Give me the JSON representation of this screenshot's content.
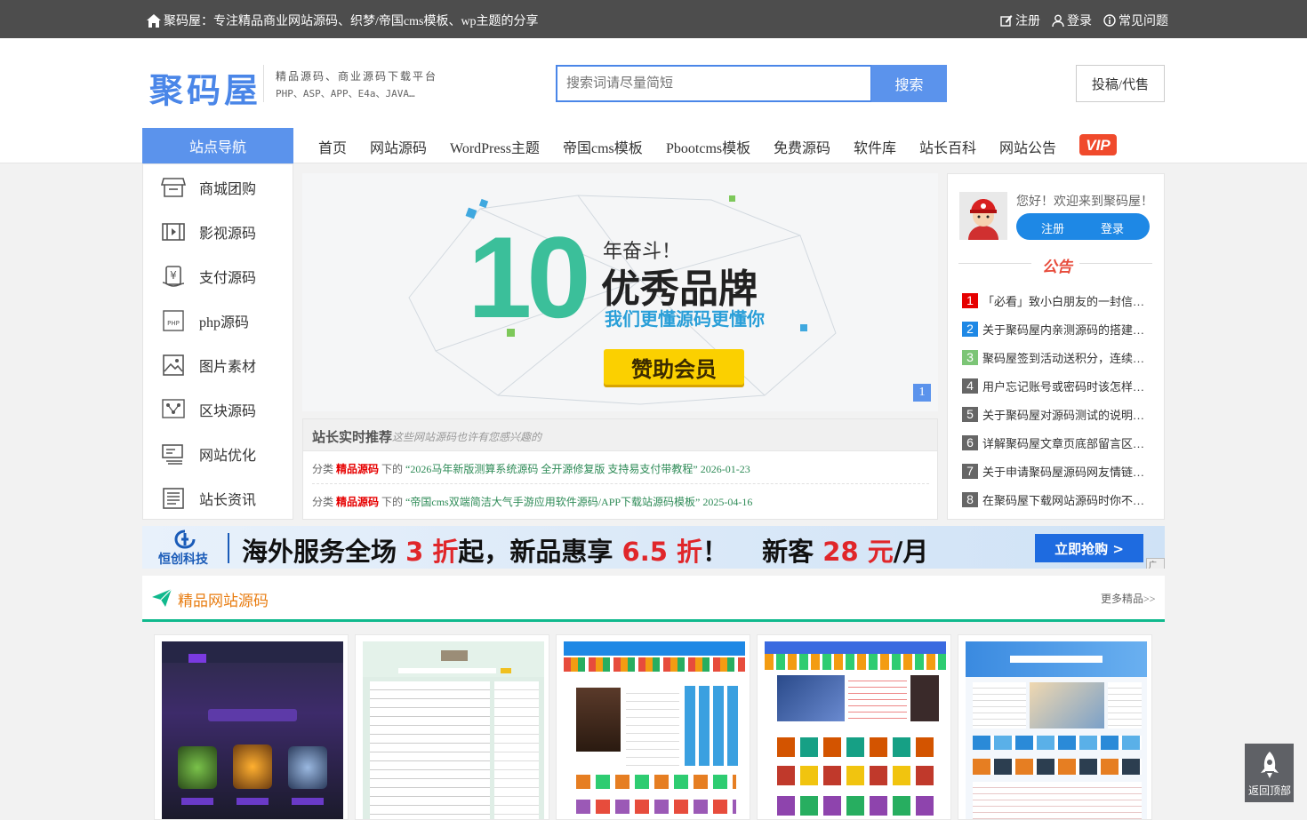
{
  "colors": {
    "topbar": "#4d4d4d",
    "accent": "#4a86e8",
    "red": "#e60000",
    "green": "#10b98d"
  },
  "topbar": {
    "slogan": "聚码屋：专注精品商业网站源码、织梦/帝国cms模板、wp主题的分享",
    "register": "注册",
    "login": "登录",
    "faq": "常见问题"
  },
  "header": {
    "logo": "聚码屋",
    "tagline1": "精品源码、商业源码下载平台",
    "tagline2": "PHP、ASP、APP、E4a、JAVA…",
    "search_placeholder": "搜索词请尽量简短",
    "search_button": "搜索",
    "submit_button": "投稿/代售"
  },
  "nav": {
    "site_nav": "站点导航",
    "items": [
      "首页",
      "网站源码",
      "WordPress主题",
      "帝国cms模板",
      "Pbootcms模板",
      "免费源码",
      "软件库",
      "站长百科",
      "网站公告"
    ]
  },
  "sidebar": [
    "商城团购",
    "影视源码",
    "支付源码",
    "php源码",
    "图片素材",
    "区块源码",
    "网站优化",
    "站长资讯"
  ],
  "banner": {
    "line1": "年奋斗！",
    "line2": "优秀品牌",
    "line3": "我们更懂源码更懂你",
    "cta": "赞助会员",
    "big": "10",
    "page": "1"
  },
  "recommend": {
    "title": "站长实时推荐",
    "subtitle": "这些网站源码也许有您感兴趣的",
    "items": [
      {
        "pre": "分类",
        "cat": "精品源码",
        "mid": "下的",
        "title": "“2026马年新版测算系统源码 全开源修复版 支持易支付带教程”",
        "date": "2026-01-23"
      },
      {
        "pre": "分类",
        "cat": "精品源码",
        "mid": "下的",
        "title": "“帝国cms双端简洁大气手游应用软件源码/APP下载站源码模板”",
        "date": "2025-04-16"
      }
    ]
  },
  "user": {
    "welcome": "您好！欢迎来到聚码屋！",
    "register": "注册",
    "login": "登录",
    "notice_title": "公告"
  },
  "notices": [
    {
      "n": "1",
      "text": "「必看」致小白朋友的一封信：…",
      "color": "#e60000"
    },
    {
      "n": "2",
      "text": "关于聚码屋内亲测源码的搭建、…",
      "color": "#1e88e5"
    },
    {
      "n": "3",
      "text": "聚码屋签到活动送积分，连续签…",
      "color": "#7cc576"
    },
    {
      "n": "4",
      "text": "用户忘记账号或密码时该怎样找…",
      "color": "#666666"
    },
    {
      "n": "5",
      "text": "关于聚码屋对源码测试的说明，…",
      "color": "#666666"
    },
    {
      "n": "6",
      "text": "详解聚码屋文章页底部留言区的…",
      "color": "#666666"
    },
    {
      "n": "7",
      "text": "关于申请聚码屋源码网友情链接…",
      "color": "#666666"
    },
    {
      "n": "8",
      "text": "在聚码屋下载网站源码时你不得…",
      "color": "#666666"
    }
  ],
  "ad": {
    "brand": "恒创科技",
    "t1": "海外服务全场",
    "n1": "3 折",
    "t2": "起，新品惠享",
    "n2": "6.5 折",
    "t3": "！",
    "t4": "新客",
    "n3": "28 元",
    "t5": "/月",
    "cta": "立即抢购 >",
    "tag": "广告"
  },
  "section": {
    "title": "精品网站源码",
    "more": "更多精品>>"
  },
  "back_top": "返回顶部"
}
